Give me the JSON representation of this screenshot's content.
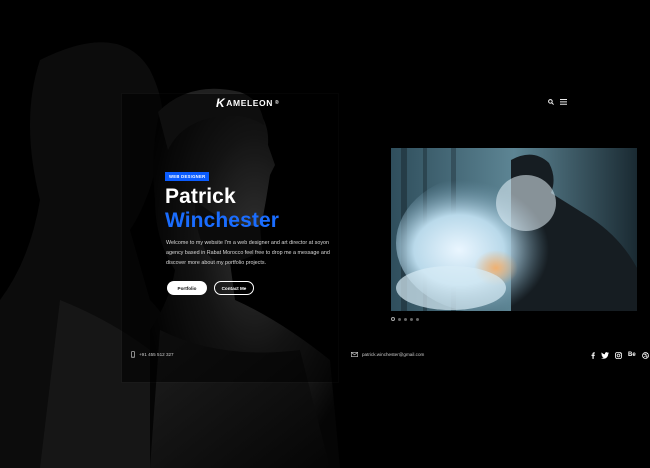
{
  "brand": {
    "logo_k": "K",
    "logo_rest": "AMELEON",
    "logo_mark": "®"
  },
  "header": {
    "search_icon": "search-icon",
    "menu_icon": "hamburger-menu-icon"
  },
  "hero": {
    "badge": "WEB DESIGNER",
    "first_name": "Patrick",
    "last_name": "Winchester",
    "bio": "Welcome to my website I'm a web designer and art director at soyon agency based in Rabat Morocco feel free to drop me a message and discover more about my portfolio projects.",
    "portfolio_label": "Portfolio",
    "contact_label": "Contact Me"
  },
  "footer": {
    "phone": "+91 455 512 327",
    "email": "patrick.winchester@gmail.com",
    "social": [
      "facebook-icon",
      "twitter-icon",
      "instagram-icon",
      "behance-icon",
      "dribbble-icon"
    ],
    "behance_label": "Be"
  },
  "slider": {
    "dots": 5,
    "active": 0
  },
  "colors": {
    "accent": "#0a5cff",
    "name_blue": "#1a6dff",
    "background": "#000000"
  }
}
